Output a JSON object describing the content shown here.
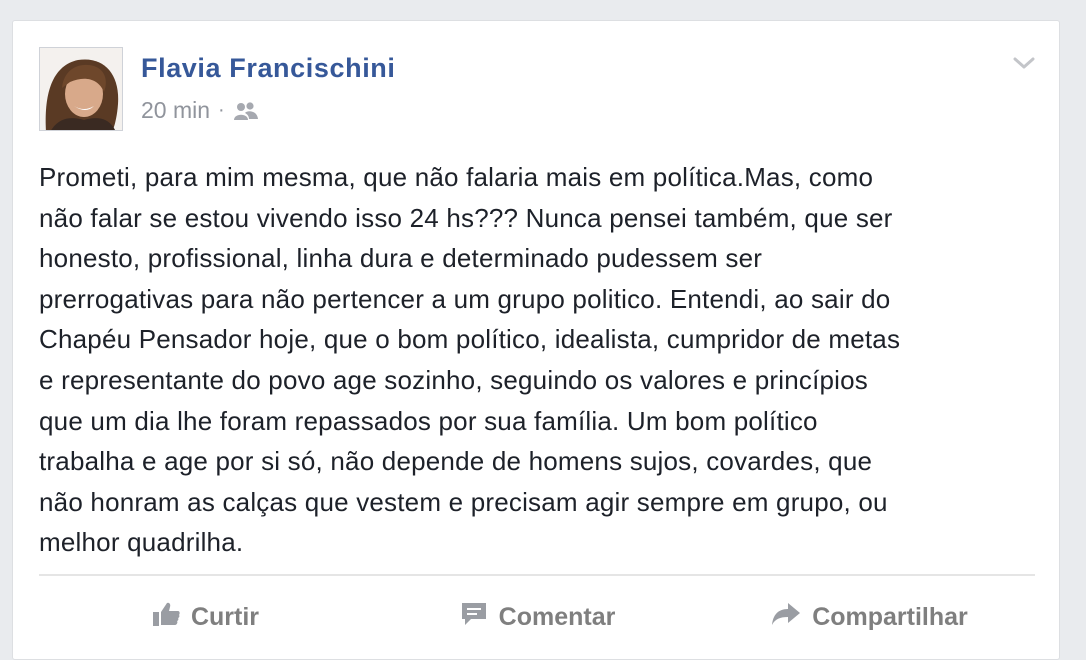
{
  "post": {
    "author": "Flavia Francischini",
    "time": "20 min",
    "separator": "·",
    "audience_icon": "friends-icon",
    "menu_icon": "chevron-down-icon",
    "text_lines": [
      "Prometi, para mim mesma, que não falaria mais em política.Mas, como",
      "não falar se estou vivendo isso 24 hs??? Nunca pensei também, que ser",
      "honesto, profissional, linha dura e determinado pudessem ser",
      "prerrogativas para não pertencer a um grupo politico. Entendi, ao sair do",
      "Chapéu Pensador hoje, que o bom político, idealista, cumpridor de metas",
      "e representante do povo age sozinho, seguindo os valores e princípios",
      "que um dia lhe foram repassados por sua família. Um bom político",
      "trabalha e age por si só, não depende de homens sujos, covardes, que",
      "não honram as calças que vestem e precisam agir sempre em grupo, ou",
      "melhor quadrilha."
    ]
  },
  "actions": {
    "like": {
      "label": "Curtir",
      "icon": "thumbs-up-icon"
    },
    "comment": {
      "label": "Comentar",
      "icon": "comment-icon"
    },
    "share": {
      "label": "Compartilhar",
      "icon": "share-icon"
    }
  },
  "colors": {
    "author": "#365899",
    "text": "#1d2129",
    "muted": "#90949c",
    "action": "#7f7f7f"
  }
}
